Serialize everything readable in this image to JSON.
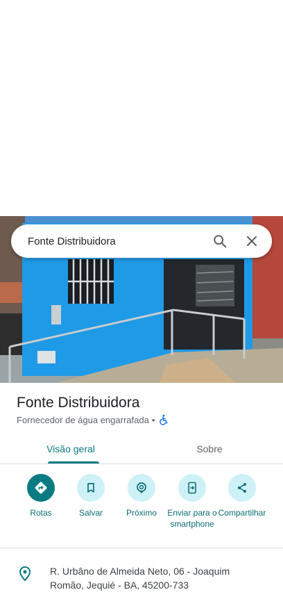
{
  "search": {
    "query": "Fonte Distribuidora"
  },
  "place": {
    "name": "Fonte Distribuidora",
    "category": "Fornecedor de água engarrafada",
    "separator": "•"
  },
  "tabs": [
    {
      "label": "Visão geral",
      "active": true
    },
    {
      "label": "Sobre",
      "active": false
    }
  ],
  "actions": [
    {
      "label": "Rotas",
      "icon": "directions-icon"
    },
    {
      "label": "Salvar",
      "icon": "bookmark-icon"
    },
    {
      "label": "Próximo",
      "icon": "nearby-icon"
    },
    {
      "label": "Enviar para o smartphone",
      "icon": "send-to-phone-icon"
    },
    {
      "label": "Compartilhar",
      "icon": "share-icon"
    }
  ],
  "address": {
    "text": "R. Urbâno de Almeida Neto, 06 - Joaquim Romão, Jequié - BA, 45200-733"
  },
  "colors": {
    "accent": "#0b7b83",
    "action_bg": "#cdf1f7",
    "wall_blue": "#1e9be8"
  }
}
